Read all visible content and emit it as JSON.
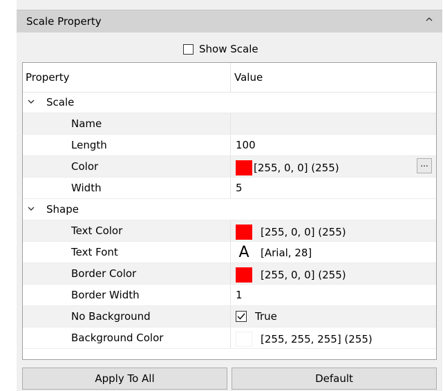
{
  "panel": {
    "title": "Scale Property",
    "collapse_icon": "chevron-up-icon"
  },
  "show_scale": {
    "label": "Show Scale",
    "checked": false
  },
  "grid": {
    "header": {
      "property": "Property",
      "value": "Value"
    },
    "categories": [
      {
        "label": "Scale",
        "rows": [
          {
            "name": "Name",
            "value": ""
          },
          {
            "name": "Length",
            "value": "100"
          },
          {
            "name": "Color",
            "value": "[255, 0, 0] (255)",
            "color": "#ff0000",
            "button": "..."
          },
          {
            "name": "Width",
            "value": "5"
          }
        ]
      },
      {
        "label": "Shape",
        "rows": [
          {
            "name": "Text Color",
            "value": "[255, 0, 0] (255)",
            "color": "#ff0000"
          },
          {
            "name": "Text Font",
            "value": "[Arial, 28]",
            "icon_glyph": "A"
          },
          {
            "name": "Border Color",
            "value": "[255, 0, 0] (255)",
            "color": "#ff0000"
          },
          {
            "name": "Border Width",
            "value": "1"
          },
          {
            "name": "No Background",
            "value": "True",
            "checked": true
          },
          {
            "name": "Background Color",
            "value": "[255, 255, 255] (255)",
            "color": "#ffffff"
          }
        ]
      }
    ]
  },
  "buttons": {
    "apply_all": "Apply To All",
    "default": "Default"
  }
}
